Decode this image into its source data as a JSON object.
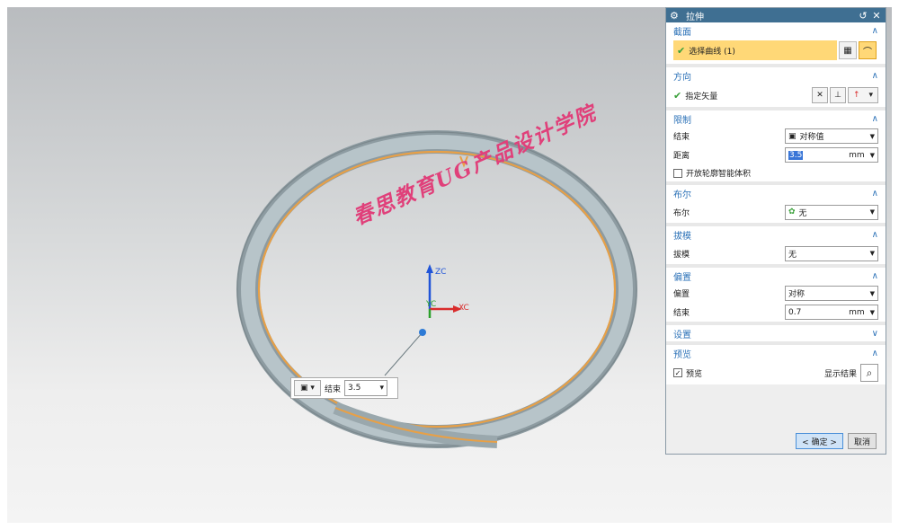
{
  "dialog": {
    "title": "拉伸",
    "sections": {
      "section": {
        "title": "截面",
        "select_label": "选择曲线 (1)"
      },
      "direction": {
        "title": "方向",
        "vector_label": "指定矢量"
      },
      "limits": {
        "title": "限制",
        "end_label": "结束",
        "end_value": "对称值",
        "distance_label": "距离",
        "distance_value": "3.5",
        "unit": "mm",
        "open_profile_label": "开放轮廓智能体积"
      },
      "boolean": {
        "title": "布尔",
        "label": "布尔",
        "value": "无"
      },
      "draft": {
        "title": "拔模",
        "label": "拔模",
        "value": "无"
      },
      "offset": {
        "title": "偏置",
        "offset_label": "偏置",
        "offset_value": "对称",
        "end_label": "结束",
        "end_value": "0.7",
        "unit": "mm"
      },
      "settings": {
        "title": "设置"
      },
      "preview": {
        "title": "预览",
        "preview_label": "预览",
        "show_result_label": "显示结果"
      }
    },
    "buttons": {
      "ok": "< 确定 >",
      "cancel": "取消"
    }
  },
  "viewport": {
    "watermark": "春思教育UG产品设计学院",
    "axis_xc": "XC",
    "axis_zc": "ZC",
    "axis_yc": "YC",
    "float_toolbar": {
      "end_label": "结束",
      "end_value": "3.5"
    }
  }
}
